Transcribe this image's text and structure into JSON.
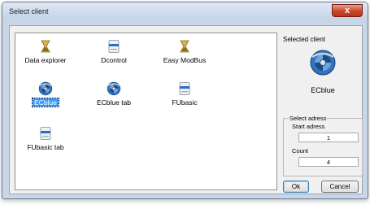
{
  "window": {
    "title": "Select client",
    "close_glyph": "x"
  },
  "clients": [
    {
      "label": "Data explorer",
      "icon": "hourglass-icon"
    },
    {
      "label": "Dcontrol",
      "icon": "drive-icon"
    },
    {
      "label": "Easy ModBus",
      "icon": "hourglass-icon"
    },
    {
      "label": "ECblue",
      "icon": "fan-icon",
      "selected": true
    },
    {
      "label": "ECblue tab",
      "icon": "fan-icon"
    },
    {
      "label": "FUbasic",
      "icon": "drive-icon"
    },
    {
      "label": "FUbasic tab",
      "icon": "drive-icon"
    }
  ],
  "selected_client": {
    "heading": "Selected client",
    "name": "ECblue",
    "icon": "fan-icon"
  },
  "address": {
    "group_label": "Select adress",
    "start_label": "Start adress",
    "start_value": "1",
    "count_label": "Count",
    "count_value": "4"
  },
  "buttons": {
    "ok": "Ok",
    "cancel": "Cancel"
  },
  "colors": {
    "selection": "#3399ff",
    "close": "#c8452b",
    "fan_blue": "#1d5fa8",
    "hourglass": "#c9a431"
  }
}
